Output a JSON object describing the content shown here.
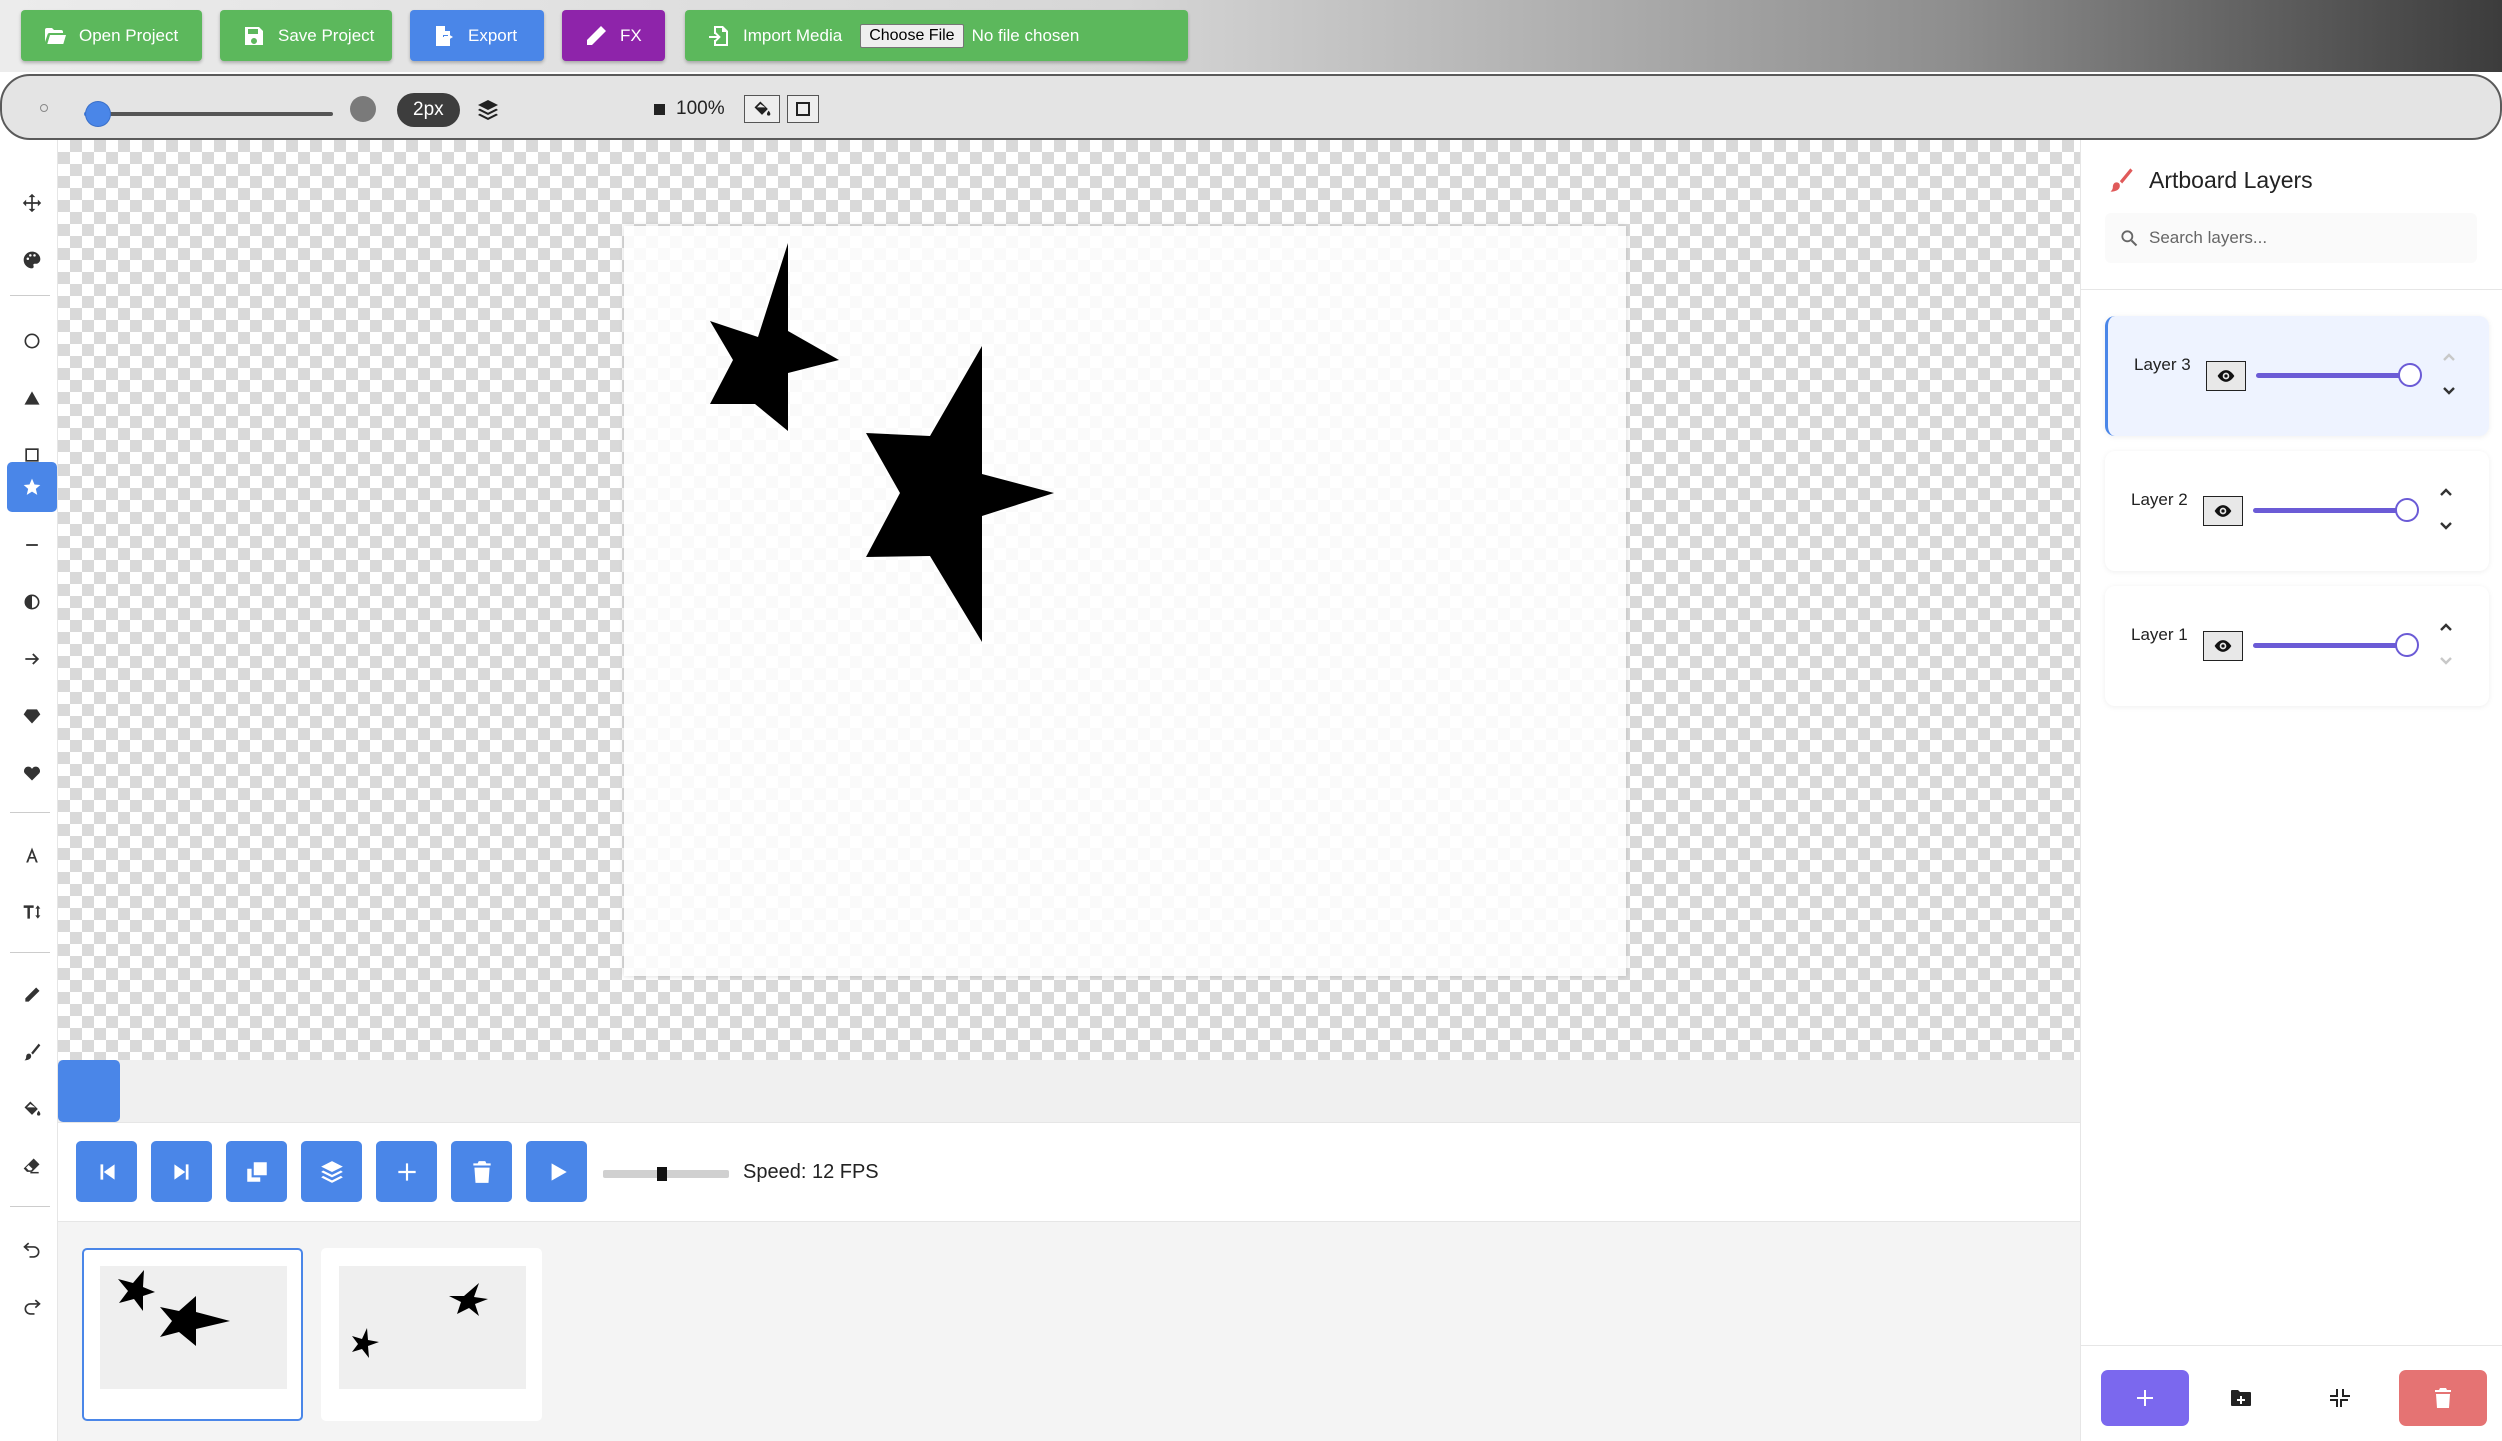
{
  "toolbar": {
    "open_label": "Open Project",
    "save_label": "Save Project",
    "export_label": "Export",
    "fx_label": "FX",
    "import_label": "Import Media",
    "choose_file_label": "Choose File",
    "no_file_label": "No file chosen"
  },
  "brush": {
    "size_label": "2px",
    "size_value": 2,
    "zoom_label": "100%"
  },
  "tools": [
    {
      "name": "move-icon",
      "active": false
    },
    {
      "name": "palette-icon",
      "active": false
    },
    {
      "name": "circle-icon",
      "active": false
    },
    {
      "name": "triangle-icon",
      "active": false
    },
    {
      "name": "square-icon",
      "active": false
    },
    {
      "name": "star-icon",
      "active": true
    },
    {
      "name": "line-icon",
      "active": false
    },
    {
      "name": "contrast-icon",
      "active": false
    },
    {
      "name": "arrow-right-icon",
      "active": false
    },
    {
      "name": "gem-icon",
      "active": false
    },
    {
      "name": "heart-icon",
      "active": false
    },
    {
      "name": "text-icon",
      "active": false
    },
    {
      "name": "text-height-icon",
      "active": false
    },
    {
      "name": "pencil-icon",
      "active": false
    },
    {
      "name": "brush-icon",
      "active": false
    },
    {
      "name": "fill-bucket-icon",
      "active": false
    },
    {
      "name": "eraser-icon",
      "active": false
    },
    {
      "name": "undo-icon",
      "active": false
    },
    {
      "name": "redo-icon",
      "active": false
    }
  ],
  "colors": {
    "accent": "#4a86e8",
    "green": "#5cb85c",
    "purple": "#8e24aa",
    "layer_slider": "#6b5bd6",
    "add_layer": "#7b68ee",
    "delete_layer": "#e57373"
  },
  "animation": {
    "speed_label": "Speed: 12 FPS",
    "fps": 12,
    "buttons": [
      "first-frame-icon",
      "last-frame-icon",
      "duplicate-frame-icon",
      "onion-skin-icon",
      "add-frame-icon",
      "delete-frame-icon",
      "play-icon"
    ]
  },
  "frames": [
    {
      "index": 1,
      "selected": true
    },
    {
      "index": 2,
      "selected": false
    }
  ],
  "layers_panel": {
    "title": "Artboard Layers",
    "search_placeholder": "Search layers...",
    "layers": [
      {
        "name": "Layer 3",
        "visible": true,
        "opacity": 1.0,
        "selected": true,
        "can_move_up": false,
        "can_move_down": true
      },
      {
        "name": "Layer 2",
        "visible": true,
        "opacity": 1.0,
        "selected": false,
        "can_move_up": true,
        "can_move_down": true
      },
      {
        "name": "Layer 1",
        "visible": true,
        "opacity": 1.0,
        "selected": false,
        "can_move_up": true,
        "can_move_down": false
      }
    ]
  }
}
